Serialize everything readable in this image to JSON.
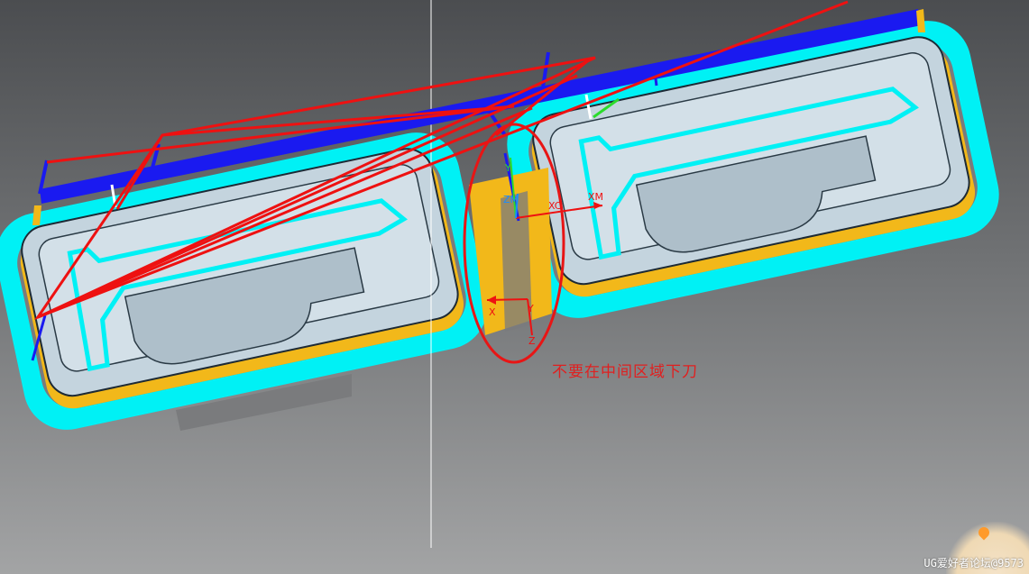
{
  "annotation": {
    "text": "不要在中间区域下刀"
  },
  "axes": {
    "work_z": "Z",
    "work_y": "Y",
    "work_xc": "XC",
    "work_xm": "XM",
    "work_zm": "ZM",
    "mcs_x": "X",
    "mcs_y": "Y",
    "mcs_z": "Z"
  },
  "watermark": {
    "text": "UG爱好者论坛@9573"
  },
  "icons": [
    "mascot-icon"
  ],
  "colors": {
    "part_fill": "#c4d4de",
    "part_stroke": "#1d2a35",
    "boundary_cyan": "#00f1f5",
    "toolpath_blue": "#1a1af0",
    "rapid_red": "#ee1111",
    "stock_yellow": "#f2b81a",
    "highlight_circle": "#e81515"
  }
}
